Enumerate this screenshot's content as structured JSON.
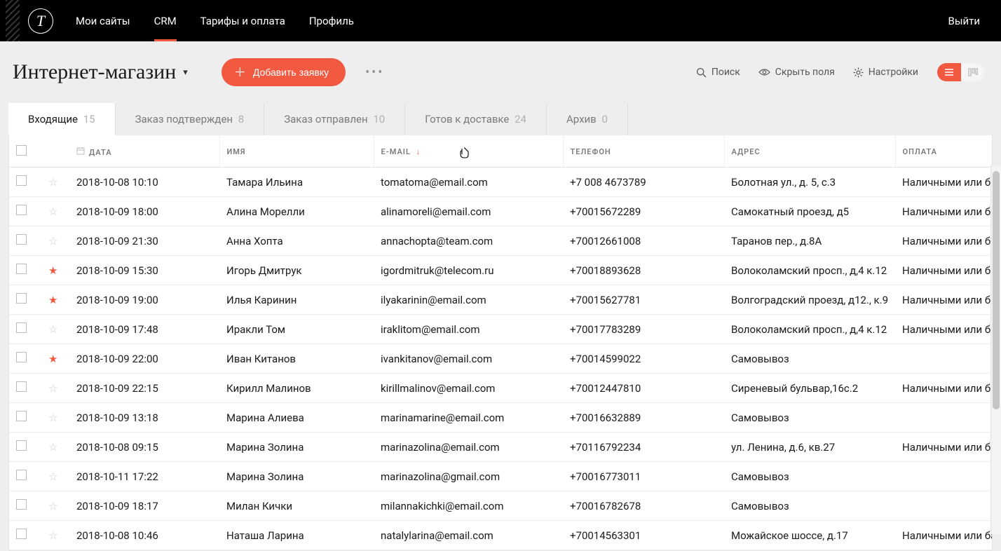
{
  "topnav": {
    "items": [
      {
        "label": "Мои сайты",
        "active": false
      },
      {
        "label": "CRM",
        "active": true
      },
      {
        "label": "Тарифы и оплата",
        "active": false
      },
      {
        "label": "Профиль",
        "active": false
      }
    ],
    "logout": "Выйти"
  },
  "header": {
    "title": "Интернет-магазин",
    "add_button": "Добавить заявку",
    "search": "Поиск",
    "hide_fields": "Скрыть поля",
    "settings": "Настройки"
  },
  "tabs": [
    {
      "label": "Входящие",
      "count": "15",
      "active": true
    },
    {
      "label": "Заказ подтвержден",
      "count": "8",
      "active": false
    },
    {
      "label": "Заказ отправлен",
      "count": "10",
      "active": false
    },
    {
      "label": "Готов к доставке",
      "count": "24",
      "active": false
    },
    {
      "label": "Архив",
      "count": "0",
      "active": false
    }
  ],
  "columns": {
    "date": "ДАТА",
    "name": "ИМЯ",
    "email": "E-MAIL",
    "phone": "ТЕЛЕФОН",
    "address": "АДРЕС",
    "payment": "ОПЛАТА"
  },
  "rows": [
    {
      "star": false,
      "date": "2018-10-08 10:10",
      "name": "Тамара Ильина",
      "email": "tomatoma@email.com",
      "phone": "+7 008 4673789",
      "address": "Болотная ул., д. 5, с.3",
      "payment": "Наличными или ба"
    },
    {
      "star": false,
      "date": "2018-10-09 18:00",
      "name": "Алина Морелли",
      "email": "alinamoreli@email.com",
      "phone": "+70015672289",
      "address": "Самокатный проезд, д5",
      "payment": "Наличными или ба"
    },
    {
      "star": false,
      "date": "2018-10-09 21:30",
      "name": "Анна Хопта",
      "email": "annachopta@team.com",
      "phone": "+70012661008",
      "address": "Таранов пер., д.8А",
      "payment": "Наличными или ба"
    },
    {
      "star": true,
      "date": "2018-10-09 15:30",
      "name": "Игорь Дмитрук",
      "email": "igordmitruk@telecom.ru",
      "phone": "+70018893628",
      "address": "Волоколамский просп., д,4 к.12",
      "payment": "Наличными или ба"
    },
    {
      "star": true,
      "date": "2018-10-09 19:00",
      "name": "Илья Каринин",
      "email": "ilyakarinin@email.com",
      "phone": "+70015627781",
      "address": "Волгоградский проезд, д12., к.9",
      "payment": "Наличными или ба"
    },
    {
      "star": false,
      "date": "2018-10-09 17:48",
      "name": "Иракли Том",
      "email": "iraklitom@email.com",
      "phone": "+70017783289",
      "address": "Волоколамский просп., д,4 к.12",
      "payment": "Наличными или ба"
    },
    {
      "star": true,
      "date": "2018-10-09 22:00",
      "name": "Иван Китанов",
      "email": "ivankitanov@email.com",
      "phone": "+70014599022",
      "address": "Самовывоз",
      "payment": ""
    },
    {
      "star": false,
      "date": "2018-10-09 22:15",
      "name": "Кирилл Малинов",
      "email": "kirillmalinov@email.com",
      "phone": "+70012447810",
      "address": "Сиреневый бульвар,16с.2",
      "payment": "Наличными или ба"
    },
    {
      "star": false,
      "date": "2018-10-09 13:18",
      "name": "Марина Алиева",
      "email": "marinamarine@email.com",
      "phone": "+70016632889",
      "address": "Самовывоз",
      "payment": ""
    },
    {
      "star": false,
      "date": "2018-10-08 09:15",
      "name": "Марина Золина",
      "email": "marinazolina@email.com",
      "phone": "+70116792234",
      "address": "ул. Ленина, д.6, кв.27",
      "payment": "Наличными или ба"
    },
    {
      "star": false,
      "date": "2018-10-11 17:22",
      "name": "Марина Золина",
      "email": "marinazolina@gmail.com",
      "phone": "+70016773011",
      "address": "Самовывоз",
      "payment": ""
    },
    {
      "star": false,
      "date": "2018-10-09 18:17",
      "name": "Милан Кички",
      "email": "milannakichki@email.com",
      "phone": "+70016782678",
      "address": "Самовывоз",
      "payment": ""
    },
    {
      "star": false,
      "date": "2018-10-08 10:46",
      "name": "Наташа Ларина",
      "email": "natalylarina@email.com",
      "phone": "+70014563301",
      "address": "Можайское шоссе, д.17",
      "payment": "Наличными или ба"
    }
  ]
}
